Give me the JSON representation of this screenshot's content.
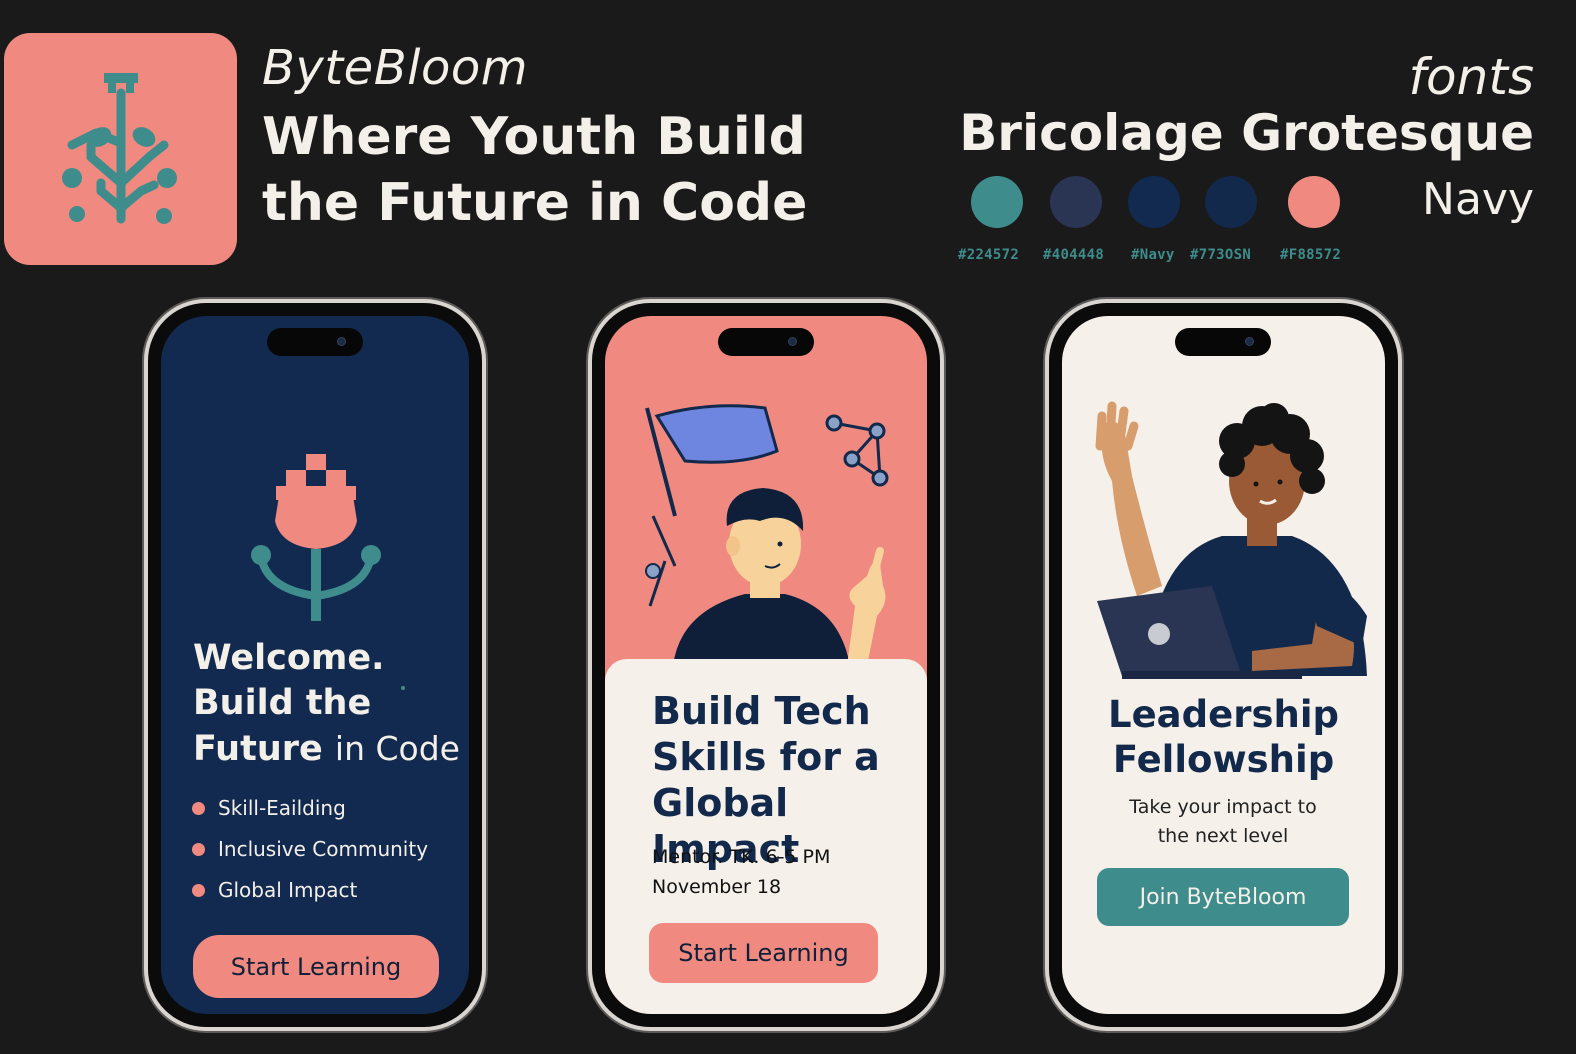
{
  "brand": {
    "name": "ByteBloom",
    "tagline": "Where Youth Build the Future in Code"
  },
  "typography": {
    "label": "fonts",
    "font_name": "Bricolage Grotesque",
    "color_name": "Navy"
  },
  "palette": [
    {
      "code": "#224572",
      "hex": "#3E8C8B"
    },
    {
      "code": "#404448",
      "hex": "#2A3554"
    },
    {
      "code": "#Navy",
      "hex": "#132A50"
    },
    {
      "code": "#773OSN",
      "hex": "#13294B"
    },
    {
      "code": "#F88572",
      "hex": "#F08A80"
    }
  ],
  "phones": [
    {
      "title_lines": [
        "Welcome.",
        "Build the",
        "Future",
        "in Code"
      ],
      "bullets": [
        "Skill-Eailding",
        "Inclusive Community",
        "Global Impact"
      ],
      "button_label": "Start Learning"
    },
    {
      "title": "Build Tech Skills for a Global Impact",
      "meta_line1": "Mentor. TK. 6-5 PM",
      "meta_line2": "November 18",
      "button_label": "Start Learning"
    },
    {
      "title": "Leadership Fellowship",
      "subtitle": "Take your impact to the next level",
      "button_label": "Join ByteBloom"
    }
  ],
  "colors": {
    "background": "#1A1A1A",
    "coral": "#F08A80",
    "teal": "#3E8C8B",
    "navy": "#13294B",
    "cream": "#F5F0EA"
  }
}
